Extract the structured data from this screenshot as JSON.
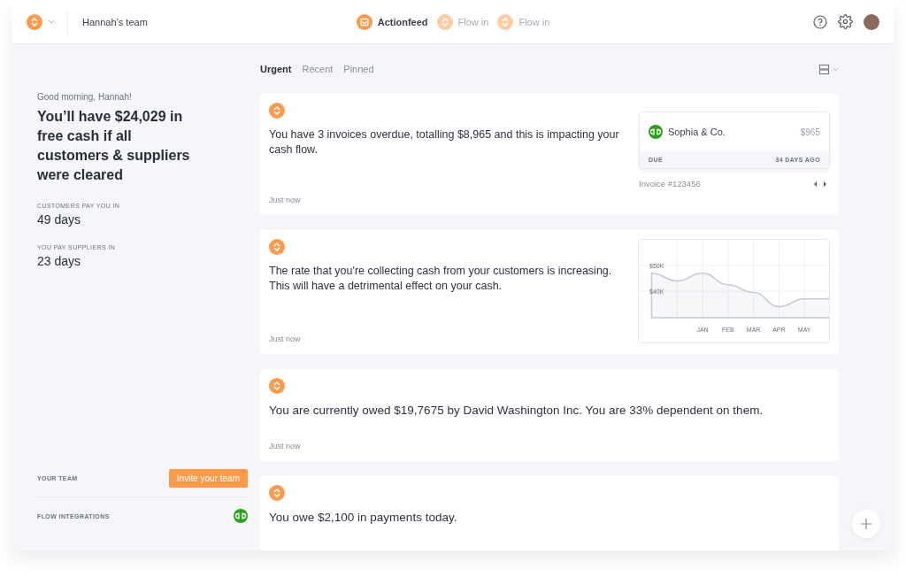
{
  "header": {
    "team": "Hannah’s team",
    "nav": [
      {
        "label": "Actionfeed",
        "selected": true
      },
      {
        "label": "Flow in",
        "selected": false
      },
      {
        "label": "Flow in",
        "selected": false
      }
    ]
  },
  "summary": {
    "greeting": "Good morning, Hannah!",
    "headline": "You’ll have $24,029 in free cash if all customers & suppliers were cleared",
    "stats": [
      {
        "label": "CUSTOMERS PAY YOU IN",
        "value": "49 days"
      },
      {
        "label": "YOU PAY SUPPLIERS IN",
        "value": "23 days"
      }
    ],
    "team_label": "YOUR TEAM",
    "invite_button": "Invite your team",
    "integrations_label": "FLOW INTEGRATIONS"
  },
  "tabs": [
    {
      "label": "Urgent",
      "selected": true
    },
    {
      "label": "Recent",
      "selected": false
    },
    {
      "label": "Pinned",
      "selected": false
    }
  ],
  "cards": [
    {
      "kind": "invoice",
      "message": "You have 3 invoices overdue, totalling $8,965 and this is impacting your cash flow.",
      "time": "Just now",
      "invoice": {
        "company": "Sophia & Co.",
        "amount": "$965",
        "due_label": "DUE",
        "due_value": "34 DAYS AGO",
        "number": "Invoice #123456"
      }
    },
    {
      "kind": "chart",
      "message": "The rate that you're collecting cash from your customers is increasing. This will have a detrimental effect on your cash.",
      "time": "Just now",
      "chart_data": {
        "type": "area",
        "grid": true,
        "categories": [
          null,
          null,
          "JAN",
          "FEB",
          "MAR",
          "APR",
          "MAY",
          null
        ],
        "series": [
          {
            "color": "#c5c8d6",
            "values": [
              47000,
              44000,
              47000,
              42500,
              39500,
              34000,
              37000,
              37000
            ]
          }
        ],
        "ylim": [
          20000,
          60000
        ],
        "yticks": [
          {
            "value": 40000,
            "label": "$40K"
          },
          {
            "value": 50000,
            "label": "$50K"
          }
        ]
      }
    },
    {
      "kind": "plain",
      "message": "You are currently owed $19,7675 by David Washington Inc. You are 33% dependent on them.",
      "time": "Just now"
    },
    {
      "kind": "plain",
      "message": "You owe $2,100 in payments today."
    }
  ]
}
